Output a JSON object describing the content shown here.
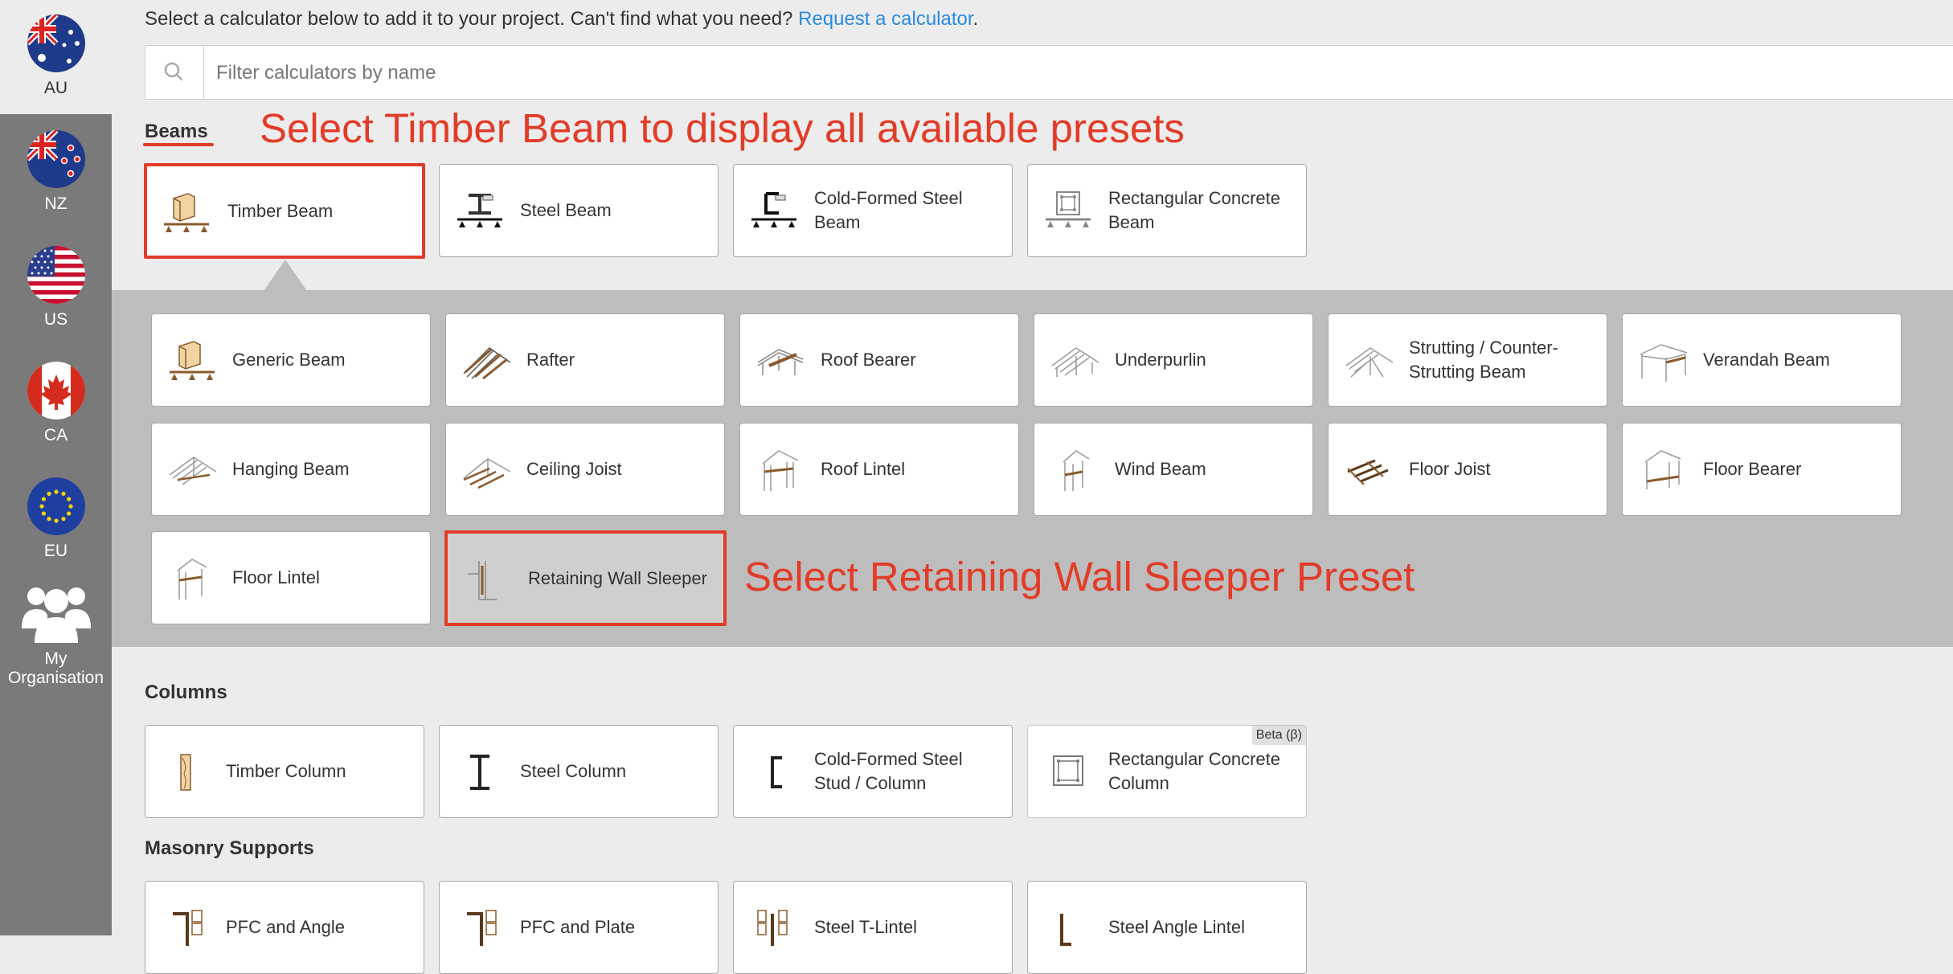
{
  "sidebar": {
    "regions": [
      {
        "code": "AU",
        "flag": "au-flag-icon"
      },
      {
        "code": "NZ",
        "flag": "nz-flag-icon"
      },
      {
        "code": "US",
        "flag": "us-flag-icon"
      },
      {
        "code": "CA",
        "flag": "ca-flag-icon"
      },
      {
        "code": "EU",
        "flag": "eu-flag-icon"
      }
    ],
    "active_region": "AU",
    "org": {
      "label": "My Organisation",
      "icon": "users-icon"
    }
  },
  "header": {
    "intro_text": "Select a calculator below to add it to your project. Can't find what you need?",
    "request_link": "Request a calculator",
    "intro_end": ".",
    "search_placeholder": "Filter calculators by name"
  },
  "sections": {
    "beams": {
      "title": "Beams",
      "cards": [
        {
          "label": "Timber Beam",
          "icon": "timber-beam-icon",
          "selected": true
        },
        {
          "label": "Steel Beam",
          "icon": "steel-beam-icon"
        },
        {
          "label": "Cold-Formed Steel Beam",
          "icon": "cold-formed-steel-beam-icon"
        },
        {
          "label": "Rectangular Concrete Beam",
          "icon": "concrete-beam-icon"
        }
      ],
      "presets": [
        {
          "label": "Generic Beam",
          "icon": "generic-beam-icon"
        },
        {
          "label": "Rafter",
          "icon": "rafter-icon"
        },
        {
          "label": "Roof Bearer",
          "icon": "roof-bearer-icon"
        },
        {
          "label": "Underpurlin",
          "icon": "underpurlin-icon"
        },
        {
          "label": "Strutting / Counter-Strutting Beam",
          "icon": "strutting-beam-icon"
        },
        {
          "label": "Verandah Beam",
          "icon": "verandah-beam-icon"
        },
        {
          "label": "Hanging Beam",
          "icon": "hanging-beam-icon"
        },
        {
          "label": "Ceiling Joist",
          "icon": "ceiling-joist-icon"
        },
        {
          "label": "Roof Lintel",
          "icon": "roof-lintel-icon"
        },
        {
          "label": "Wind Beam",
          "icon": "wind-beam-icon"
        },
        {
          "label": "Floor Joist",
          "icon": "floor-joist-icon"
        },
        {
          "label": "Floor Bearer",
          "icon": "floor-bearer-icon"
        },
        {
          "label": "Floor Lintel",
          "icon": "floor-lintel-icon"
        },
        {
          "label": "Retaining Wall Sleeper",
          "icon": "retaining-wall-sleeper-icon",
          "selected": true
        }
      ]
    },
    "columns": {
      "title": "Columns",
      "cards": [
        {
          "label": "Timber Column",
          "icon": "timber-column-icon"
        },
        {
          "label": "Steel Column",
          "icon": "steel-column-icon"
        },
        {
          "label": "Cold-Formed Steel Stud / Column",
          "icon": "cold-formed-stud-icon"
        },
        {
          "label": "Rectangular Concrete Column",
          "icon": "concrete-column-icon",
          "badge": "Beta (β)"
        }
      ]
    },
    "masonry": {
      "title": "Masonry Supports",
      "cards": [
        {
          "label": "PFC and Angle",
          "icon": "pfc-angle-icon"
        },
        {
          "label": "PFC and Plate",
          "icon": "pfc-plate-icon"
        },
        {
          "label": "Steel T-Lintel",
          "icon": "steel-t-lintel-icon"
        },
        {
          "label": "Steel Angle Lintel",
          "icon": "steel-angle-lintel-icon"
        }
      ]
    }
  },
  "annotations": {
    "timber": "Select Timber Beam to display all available presets",
    "sleeper": "Select Retaining Wall Sleeper Preset"
  },
  "colors": {
    "accent": "#e23c28",
    "link": "#2a8ae0",
    "sidebar": "#7a7a7a",
    "panel": "#bdbdbd"
  }
}
